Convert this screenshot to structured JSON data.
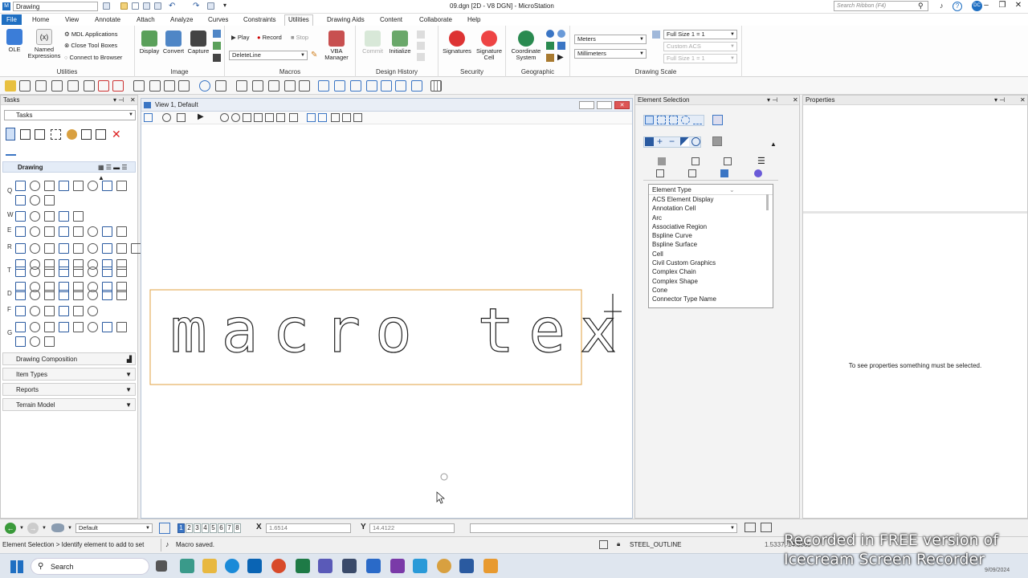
{
  "window": {
    "workspace": "Drawing",
    "title": "09.dgn [2D - V8 DGN] - MicroStation",
    "search_placeholder": "Search Ribbon (F4)",
    "user_initials": "DC"
  },
  "tabs": [
    "File",
    "Home",
    "View",
    "Annotate",
    "Attach",
    "Analyze",
    "Curves",
    "Constraints",
    "Utilities",
    "Drawing Aids",
    "Content",
    "Collaborate",
    "Help"
  ],
  "active_tab": "Utilities",
  "ribbon": {
    "utilities": {
      "label": "Utilities",
      "ole": "OLE",
      "named_expressions": "Named Expressions",
      "mdl_applications": "MDL Applications",
      "close_tool_boxes": "Close Tool Boxes",
      "connect_to_browser": "Connect to Browser"
    },
    "image": {
      "label": "Image",
      "display": "Display",
      "convert": "Convert",
      "capture": "Capture"
    },
    "macros": {
      "label": "Macros",
      "play": "Play",
      "record": "Record",
      "stop": "Stop",
      "macro_name": "DeleteLine",
      "vba_manager": "VBA Manager"
    },
    "design_history": {
      "label": "Design History",
      "commit": "Commit",
      "initialize": "Initialize"
    },
    "security": {
      "label": "Security",
      "signatures": "Signatures",
      "signature_cell": "Signature Cell"
    },
    "geographic": {
      "label": "Geographic",
      "coordinate_system": "Coordinate System"
    },
    "drawing_scale": {
      "label": "Drawing Scale",
      "units_1": "Meters",
      "units_2": "Millimeters",
      "scale": "Full Size 1 = 1",
      "acs": "Custom ACS",
      "scale_2": "Full Size 1 = 1"
    }
  },
  "tasks_panel": {
    "title": "Tasks",
    "dropdown": "Tasks",
    "drawing_section": "Drawing",
    "row_letters": [
      "Q",
      "W",
      "E",
      "R",
      "T",
      "D",
      "F",
      "G"
    ],
    "collapsed_sections": [
      "Drawing Composition",
      "Item Types",
      "Reports",
      "Terrain Model"
    ]
  },
  "view": {
    "title": "View 1, Default",
    "drawn_text": "macro text"
  },
  "element_selection": {
    "title": "Element Selection",
    "list_header": "Element Type",
    "items": [
      "ACS Element Display",
      "Annotation Cell",
      "Arc",
      "Associative Region",
      "Bspline Curve",
      "Bspline Surface",
      "Cell",
      "Civil Custom Graphics",
      "Complex Chain",
      "Complex Shape",
      "Cone",
      "Connector Type Name"
    ]
  },
  "properties": {
    "title": "Properties",
    "message": "To see properties something must be selected."
  },
  "bottom": {
    "level": "Default",
    "views": [
      "1",
      "2",
      "3",
      "4",
      "5",
      "6",
      "7",
      "8"
    ],
    "x_label": "X",
    "x_value": "1.6514",
    "y_label": "Y",
    "y_value": "14.4122"
  },
  "status": {
    "prompt": "Element Selection > Identify element to add to set",
    "message": "Macro saved.",
    "active_level": "STEEL_OUTLINE",
    "coords": "1.5337, 14.3565"
  },
  "taskbar": {
    "search": "Search",
    "time": "9/09/2024"
  },
  "watermark": {
    "line1": "Recorded in FREE version of",
    "line2": "Icecream  Screen  Recorder"
  },
  "colors": {
    "accent": "#1f6fc2",
    "selection_box": "#e0a040"
  }
}
